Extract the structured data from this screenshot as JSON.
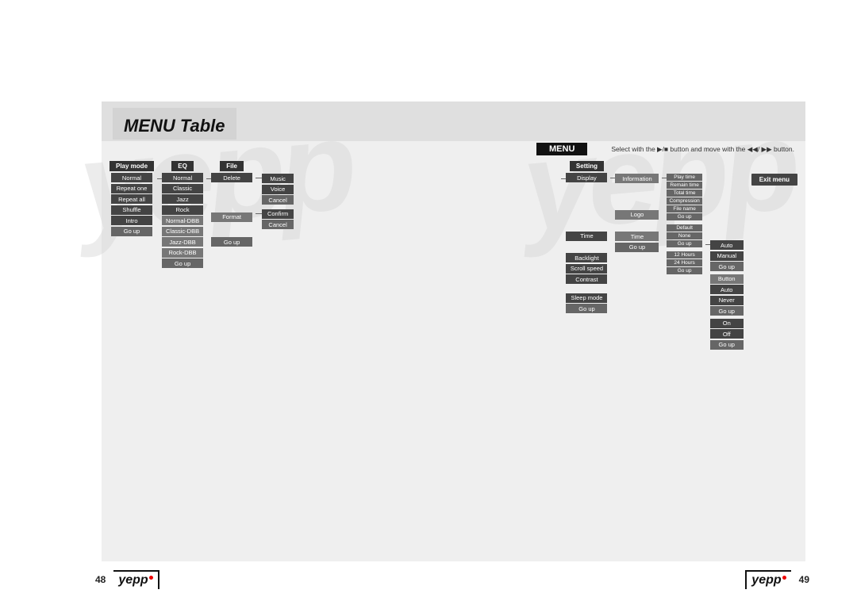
{
  "page": {
    "title": "MENU Table",
    "menu_badge": "MENU",
    "instruction": "Select with the ▶/■ button and move with the ◀◀/ ▶▶ button.",
    "page_left": "48",
    "page_right": "49",
    "yepp_label": "yepp"
  },
  "play_mode": {
    "header": "Play mode",
    "items": [
      "Normal",
      "Repeat one",
      "Repeat all",
      "Shuffle",
      "Intro",
      "Go up"
    ]
  },
  "eq": {
    "header": "EQ",
    "items": [
      "Normal",
      "Classic",
      "Jazz",
      "Rock",
      "Normal-DBB",
      "Classic-DBB",
      "Jazz-DBB",
      "Rock-DBB",
      "Go up"
    ]
  },
  "file": {
    "header": "File",
    "delete": "Delete",
    "delete_children": [
      "Music",
      "Voice",
      "Cancel"
    ],
    "format": "Format",
    "format_children": [
      "Confirm",
      "Cancel"
    ],
    "go_up": "Go up"
  },
  "setting": {
    "header": "Setting",
    "display": "Display",
    "information": "Information",
    "info_items": [
      "Play time",
      "Remain time",
      "Total time",
      "Compression",
      "File name",
      "Go up"
    ],
    "logo": "Logo",
    "logo_items": [
      "Default",
      "None",
      "Go up"
    ],
    "time_label": "Time",
    "time_items": [
      "12 Hours",
      "24 Hours",
      "Go up"
    ],
    "go_up": "Go up",
    "time_section": "Time",
    "time_section_items": [
      "Auto",
      "Manual",
      "Go up"
    ],
    "backlight": "Backlight",
    "backlight_val": "Button",
    "scroll_speed": "Scroll speed",
    "scroll_items": [
      "Auto",
      "Never",
      "Go up"
    ],
    "contrast": "Contrast",
    "sleep_mode": "Sleep mode",
    "sleep_items": [
      "On",
      "Off"
    ],
    "go_up2": "Go up"
  },
  "exit_menu": "Exit menu"
}
